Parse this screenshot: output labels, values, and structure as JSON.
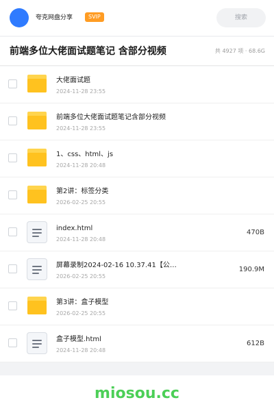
{
  "header": {
    "user_name": "夸克网盘分享",
    "badge": "SVIP",
    "search_label": "搜索",
    "avatar_color": "#2f7bff",
    "badge_color": "#ff9c23"
  },
  "folder_header": {
    "title": "前端多位大佬面试题笔记 含部分视频",
    "meta": "共 4927 项 · 68.6G"
  },
  "files": [
    {
      "type": "folder",
      "icon": "folder-icon",
      "name": "大佬面试题",
      "date": "2024-11-28 23:55",
      "size": ""
    },
    {
      "type": "folder",
      "icon": "folder-icon",
      "name": "前端多位大佬面试题笔记含部分视频",
      "date": "2024-11-28 23:55",
      "size": ""
    },
    {
      "type": "folder",
      "icon": "folder-icon",
      "name": "1、css、html、js",
      "date": "2024-11-28 20:48",
      "size": ""
    },
    {
      "type": "folder",
      "icon": "folder-icon",
      "name": "第2讲：标签分类",
      "date": "2026-02-25 20:55",
      "size": ""
    },
    {
      "type": "file",
      "icon": "document-icon",
      "name": "index.html",
      "date": "2024-11-28 20:48",
      "size": "470B"
    },
    {
      "type": "file",
      "icon": "document-icon",
      "name": "屏幕录制2024-02-16 10.37.41【公…",
      "date": "2026-02-25 20:55",
      "size": "190.9M"
    },
    {
      "type": "folder",
      "icon": "folder-icon",
      "name": "第3讲：盒子模型",
      "date": "2026-02-25 20:55",
      "size": ""
    },
    {
      "type": "file",
      "icon": "document-icon",
      "name": "盒子模型.html",
      "date": "2024-11-28 20:48",
      "size": "612B"
    }
  ],
  "footer": {
    "brand": "miosou.cc",
    "brand_color": "#4ccf57"
  }
}
